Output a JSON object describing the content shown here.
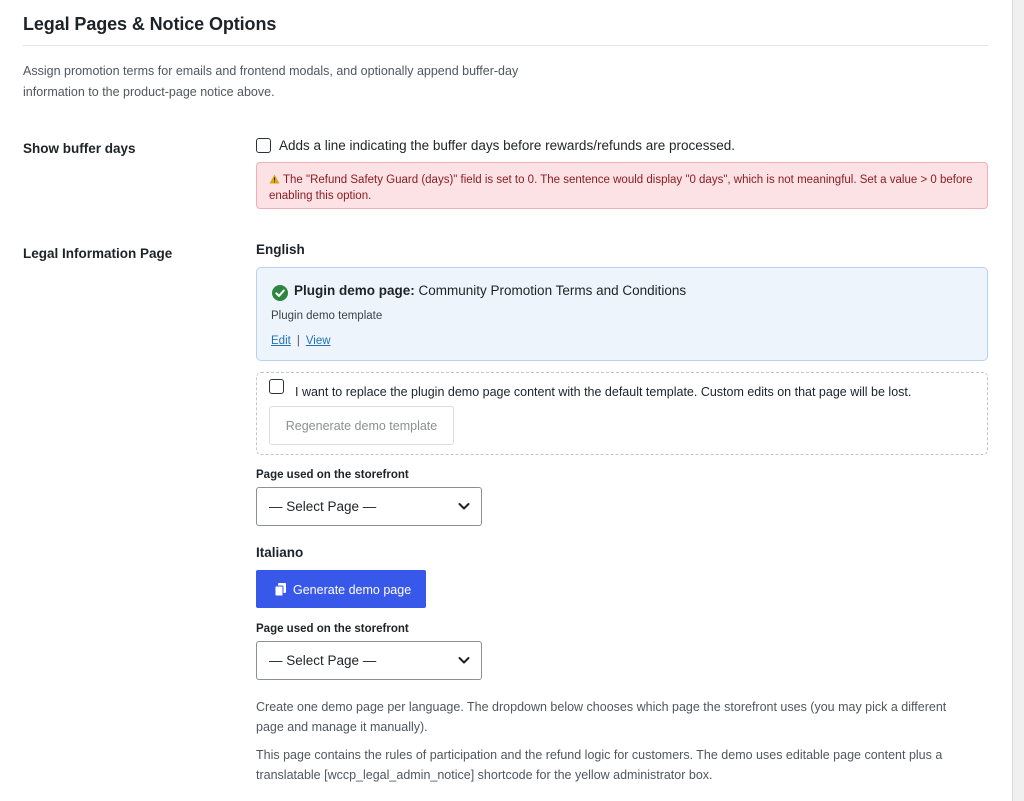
{
  "section": {
    "title": "Legal Pages & Notice Options",
    "intro": "Assign promotion terms for emails and frontend modals, and optionally append buffer-day information to the product-page notice above."
  },
  "buffer": {
    "label": "Show buffer days",
    "checkbox_text": "Adds a line indicating the buffer days before rewards/refunds are processed.",
    "checked": false,
    "error": "The \"Refund Safety Guard (days)\" field is set to 0. The sentence would display \"0 days\", which is not meaningful. Set a value > 0 before enabling this option."
  },
  "legal": {
    "label": "Legal Information Page",
    "english": {
      "heading": "English",
      "demo_label": "Plugin demo page:",
      "demo_page_title": "Community Promotion Terms and Conditions",
      "demo_template": "Plugin demo template",
      "edit_link": "Edit",
      "separator": "|",
      "view_link": "View",
      "replace_text": "I want to replace the plugin demo page content with the default template. Custom edits on that page will be lost.",
      "regenerate_button": "Regenerate demo template",
      "storefront_label": "Page used on the storefront",
      "select_value": "— Select Page —"
    },
    "italiano": {
      "heading": "Italiano",
      "generate_button": "Generate demo page",
      "storefront_label": "Page used on the storefront",
      "select_value": "— Select Page —"
    },
    "description_1": "Create one demo page per language. The dropdown below chooses which page the storefront uses (you may pick a different page and manage it manually).",
    "description_2": "This page contains the rules of participation and the refund logic for customers. The demo uses editable page content plus a translatable [wccp_legal_admin_notice] shortcode for the yellow administrator box."
  },
  "colors": {
    "primary": "#3858e9",
    "link": "#2271b1",
    "success": "#2e8540",
    "error_bg": "#fce2e4",
    "info_bg": "#eef4fc",
    "warning": "#dba617"
  },
  "icons": {
    "warning": "warning-icon",
    "success": "check-circle-icon",
    "copy": "copy-icon",
    "dropdown": "chevron-down-icon"
  }
}
